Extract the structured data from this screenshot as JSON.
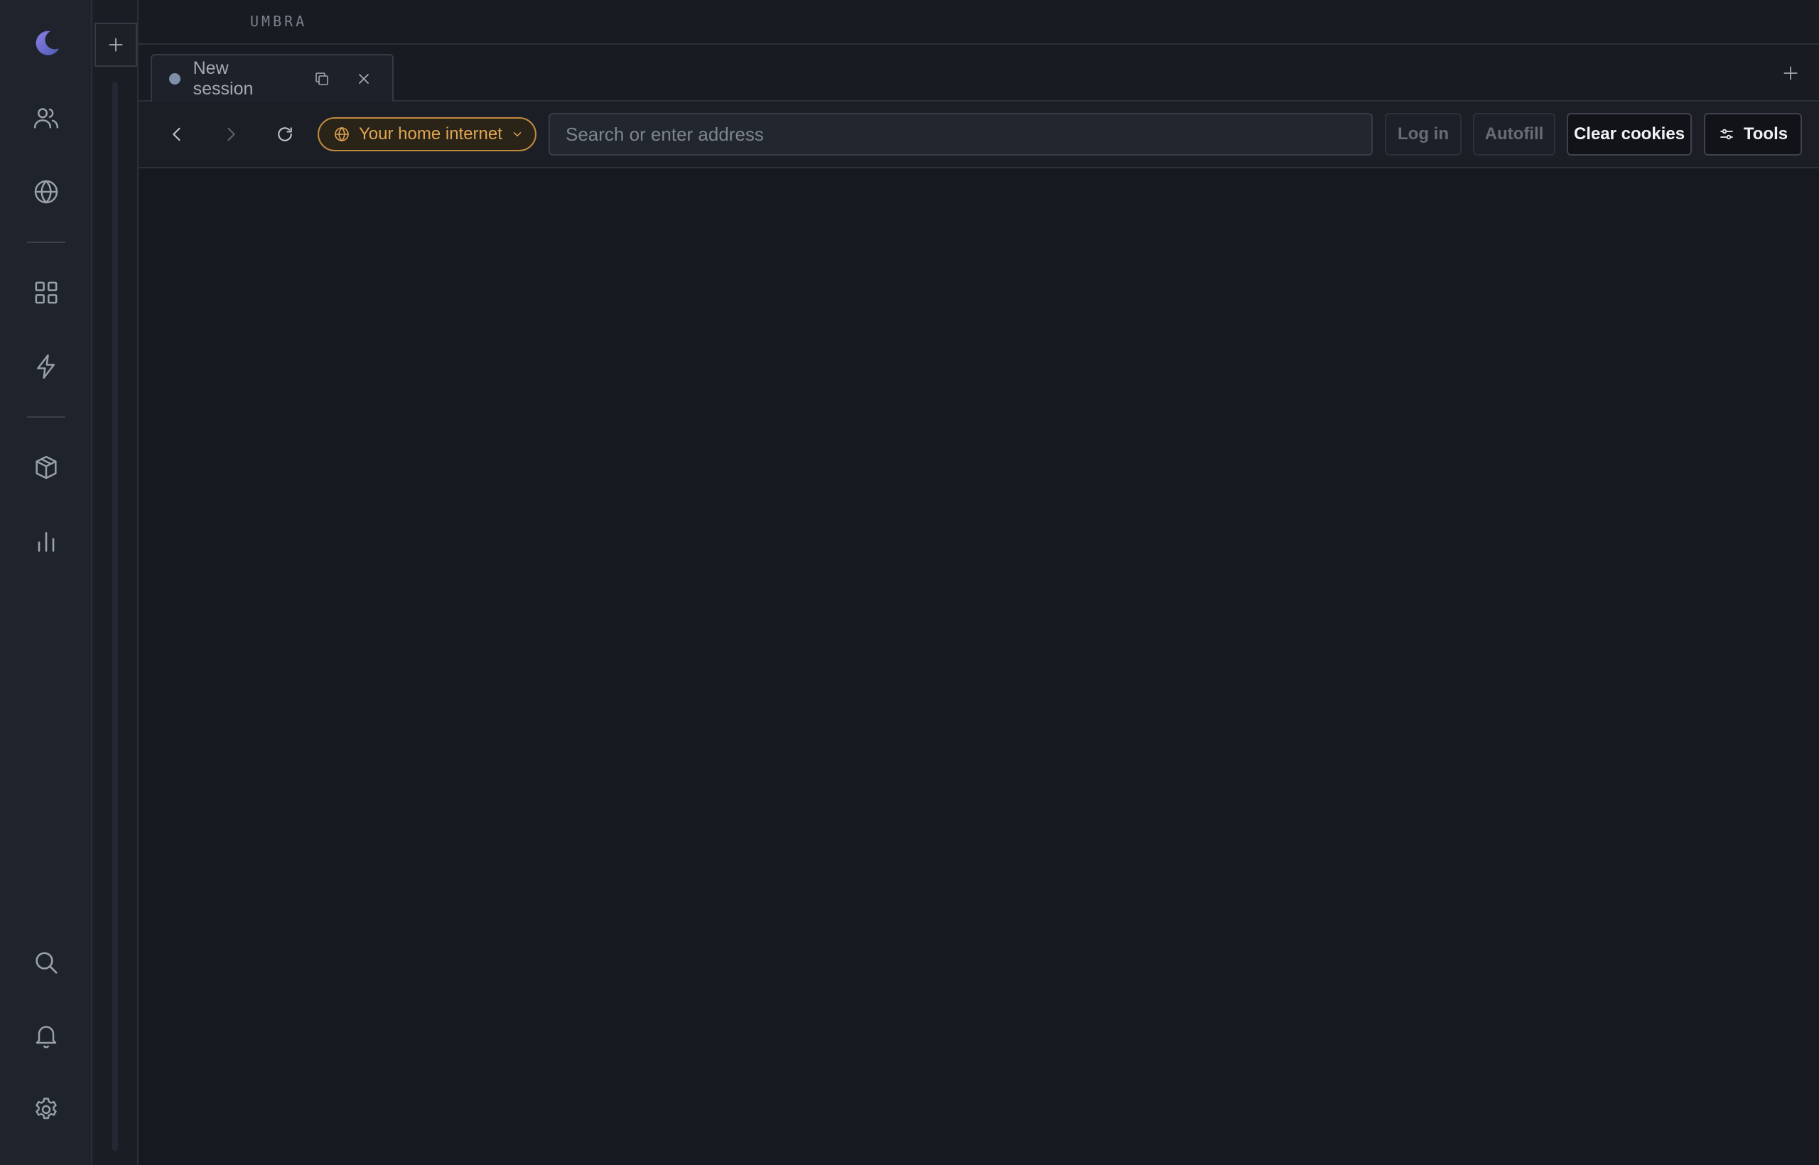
{
  "app": {
    "brand": "UMBRA",
    "logo_icon": "crescent-moon-icon",
    "accent": "#6a6fd1"
  },
  "rail": {
    "top_items": [
      {
        "icon": "users-icon"
      },
      {
        "icon": "globe-icon"
      },
      {
        "icon": "grid-icon"
      },
      {
        "icon": "lightning-icon"
      },
      {
        "icon": "package-icon"
      },
      {
        "icon": "bar-chart-icon"
      }
    ],
    "bottom_items": [
      {
        "icon": "search-icon"
      },
      {
        "icon": "bell-icon"
      },
      {
        "icon": "gear-icon"
      }
    ]
  },
  "tabs": [
    {
      "label": "New session",
      "status_color": "#7f8fa8",
      "active": true
    }
  ],
  "toolbar": {
    "proxy_label": "Your home internet",
    "proxy_color": "#e1a452",
    "address_placeholder": "Search or enter address",
    "address_value": "",
    "login_label": "Log in",
    "autofill_label": "Autofill",
    "clear_cookies_label": "Clear cookies",
    "tools_label": "Tools"
  }
}
